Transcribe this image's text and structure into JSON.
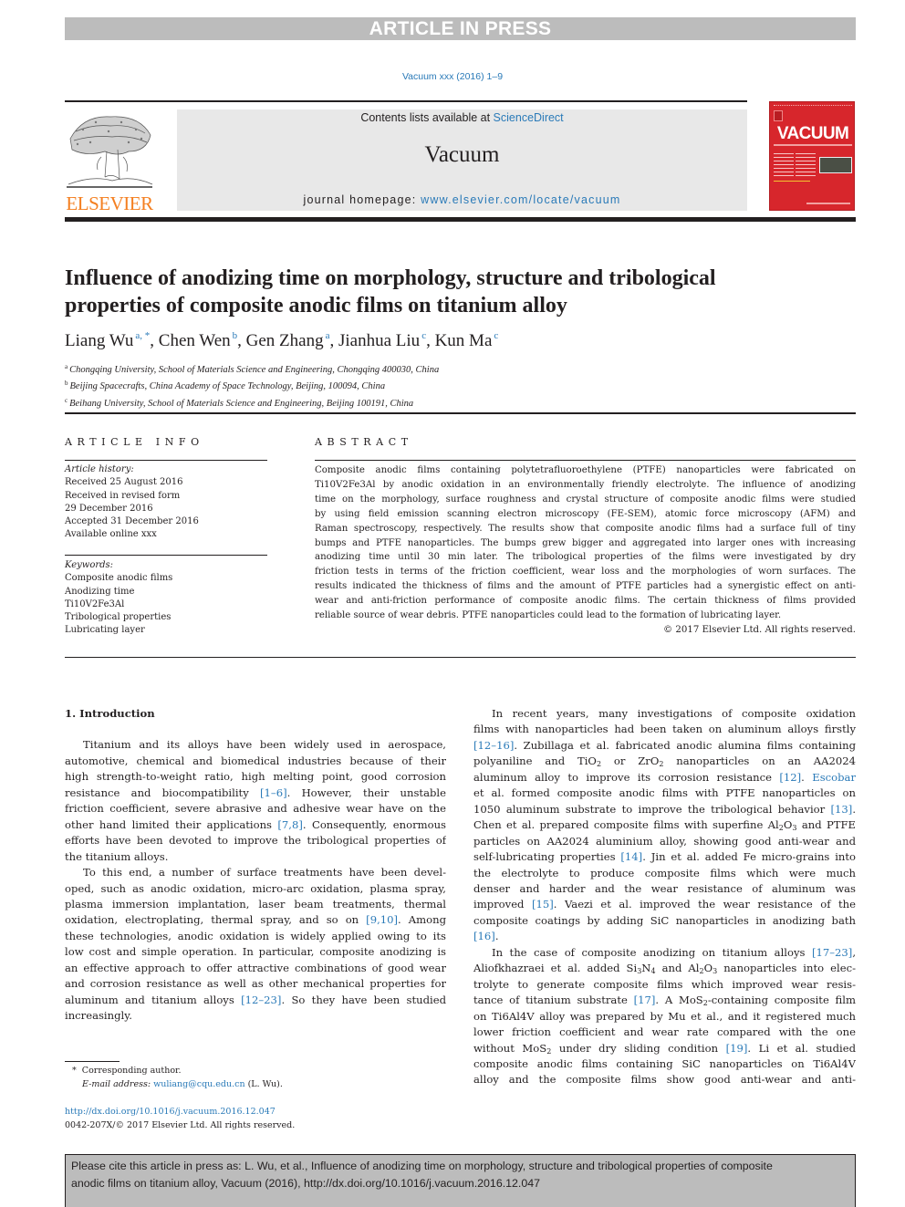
{
  "banner": {
    "label": "ARTICLE IN PRESS"
  },
  "journal_ref": "Vacuum xxx (2016) 1–9",
  "masthead": {
    "contents_prefix": "Contents lists available at ",
    "contents_link": "ScienceDirect",
    "journal_name": "Vacuum",
    "homepage_prefix": "journal homepage: ",
    "homepage_link": "www.elsevier.com/locate/vacuum",
    "publisher_logo_text": "ELSEVIER",
    "cover_title": "VACUUM"
  },
  "article": {
    "title_lines": [
      "Influence of anodizing time on morphology, structure and tribological",
      "properties of composite anodic films on titanium alloy"
    ],
    "authors": [
      {
        "name": "Liang Wu",
        "marks": "a, *"
      },
      {
        "name": "Chen Wen",
        "marks": "b"
      },
      {
        "name": "Gen Zhang",
        "marks": "a"
      },
      {
        "name": "Jianhua Liu",
        "marks": "c"
      },
      {
        "name": "Kun Ma",
        "marks": "c"
      }
    ],
    "affiliations": [
      {
        "mark": "a",
        "text": "Chongqing University, School of Materials Science and Engineering, Chongqing 400030, China"
      },
      {
        "mark": "b",
        "text": "Beijing Spacecrafts, China Academy of Space Technology, Beijing, 100094, China"
      },
      {
        "mark": "c",
        "text": "Beihang University, School of Materials Science and Engineering, Beijing 100191, China"
      }
    ]
  },
  "article_info": {
    "heading": "ARTICLE INFO",
    "history_label": "Article history:",
    "history": [
      "Received 25 August 2016",
      "Received in revised form",
      "29 December 2016",
      "Accepted 31 December 2016",
      "Available online xxx"
    ],
    "keywords_label": "Keywords:",
    "keywords": [
      "Composite anodic films",
      "Anodizing time",
      "Ti10V2Fe3Al",
      "Tribological properties",
      "Lubricating layer"
    ]
  },
  "abstract": {
    "heading": "ABSTRACT",
    "lines": [
      "Composite anodic films containing polytetrafluoroethylene (PTFE) nanoparticles were fabricated on",
      "Ti10V2Fe3Al by anodic oxidation in an environmentally friendly electrolyte. The influence of anodizing",
      "time on the morphology, surface roughness and crystal structure of composite anodic films were studied",
      "by using field emission scanning electron microscopy (FE-SEM), atomic force microscopy (AFM) and",
      "Raman spectroscopy, respectively. The results show that composite anodic films had a surface full of tiny",
      "bumps and PTFE nanoparticles. The bumps grew bigger and aggregated into larger ones with increasing",
      "anodizing time until 30 min later. The tribological properties of the films were investigated by dry",
      "friction tests in terms of the friction coefficient, wear loss and the morphologies of worn surfaces. The",
      "results indicated the thickness of films and the amount of PTFE particles had a synergistic effect on anti-",
      "wear and anti-friction performance of composite anodic films. The certain thickness of films provided"
    ],
    "last_line": "reliable source of wear debris. PTFE nanoparticles could lead to the formation of lubricating layer.",
    "copyright": "© 2017 Elsevier Ltd. All rights reserved."
  },
  "body": {
    "section_heading": "1.  Introduction",
    "left": {
      "p1": {
        "lines": [
          [
            "Titanium and its alloys have been widely used in aerospace,"
          ],
          [
            "automotive, chemical and biomedical industries because of their"
          ],
          [
            "high strength-to-weight ratio, high melting point, good corrosion"
          ],
          [
            "resistance and biocompatibility ",
            "[1–6]",
            ". However, their unstable"
          ],
          [
            "friction coefficient, severe abrasive and adhesive wear have on the"
          ],
          [
            "other hand limited their applications ",
            "[7,8]",
            ". Consequently, enormous"
          ],
          [
            "efforts have been devoted to improve the tribological properties of"
          ]
        ],
        "last": "the titanium alloys."
      },
      "p2": {
        "lines": [
          [
            "To this end, a number of surface treatments have been devel-"
          ],
          [
            "oped, such as anodic oxidation, micro-arc oxidation, plasma spray,"
          ],
          [
            "plasma immersion implantation, laser beam treatments, thermal"
          ],
          [
            "oxidation, electroplating, thermal spray, and so on ",
            "[9,10]",
            ". Among"
          ],
          [
            "these technologies, anodic oxidation is widely applied owing to its"
          ],
          [
            "low cost and simple operation. In particular, composite anodizing is"
          ],
          [
            "an effective approach to offer attractive combinations of good wear"
          ],
          [
            "and corrosion resistance as well as other mechanical properties for"
          ],
          [
            "aluminum and titanium alloys ",
            "[12–23]",
            ". So they have been studied"
          ]
        ],
        "last": "increasingly."
      }
    },
    "right": {
      "p1": {
        "l1": "In recent years, many investigations of composite oxidation",
        "l2": "films with nanoparticles had been taken on aluminum alloys firstly",
        "l3_cite": "[12–16]",
        "l3_text": ". Zubillaga et al. fabricated anodic alumina films containing",
        "l4_a": "polyaniline and TiO",
        "l4_b": " or ZrO",
        "l4_c": " nanoparticles on an AA2024",
        "l5_text": "aluminum alloy to improve its corrosion resistance ",
        "l5_cite": "[12]",
        "l5_link": "Escobar",
        "l6": "et al. formed composite anodic films with PTFE nanoparticles on",
        "l7_text": "1050 aluminum substrate to improve the tribological behavior ",
        "l7_cite": "[13]",
        "l8_a": "Chen et al. prepared composite films with superfine Al",
        "l8_b": "O",
        "l8_c": " and PTFE",
        "l9": "particles on AA2024 aluminium alloy, showing good anti-wear and",
        "l10_text": "self-lubricating properties ",
        "l10_cite": "[14]",
        "l10_rest": ". Jin et al. added Fe micro-grains into",
        "l11": "the electrolyte to produce composite films which were much",
        "l12": "denser and harder and the wear resistance of aluminum was",
        "l13_text": "improved ",
        "l13_cite": "[15]",
        "l13_rest": ". Vaezi et al. improved the wear resistance of the",
        "l14": "composite coatings by adding SiC nanoparticles in anodizing bath",
        "l15_cite": "[16]"
      },
      "p2": {
        "l1_text": "In the case of composite anodizing on titanium alloys ",
        "l1_cite": "[17–23]",
        "l2_a": "Aliofkhazraei et al. added Si",
        "l2_b": "N",
        "l2_c": " and Al",
        "l2_d": "O",
        "l2_e": " nanoparticles into elec-",
        "l3": "trolyte to generate composite films which improved wear resis-",
        "l4_text": "tance of titanium substrate ",
        "l4_cite": "[17]",
        "l4_rest": ". A MoS",
        "l4_rest2": "-containing composite film",
        "l5": "on Ti6Al4V alloy was prepared by Mu et al., and it registered much",
        "l6": "lower friction coefficient and wear rate compared with the one",
        "l7_a": "without MoS",
        "l7_b": " under dry sliding condition ",
        "l7_cite": "[19]",
        "l7_rest": ". Li et al. studied",
        "l8": "composite anodic films containing SiC nanoparticles on Ti6Al4V",
        "l9": "alloy and the composite films show good anti-wear and anti-"
      }
    }
  },
  "footnote": {
    "star": "*",
    "corresponding": "Corresponding author.",
    "email_label": "E-mail address:",
    "email": "wuliang@cqu.edu.cn",
    "email_suffix": " (L. Wu)."
  },
  "doi": {
    "link": "http://dx.doi.org/10.1016/j.vacuum.2016.12.047",
    "issn": "0042-207X/© 2017 Elsevier Ltd. All rights reserved."
  },
  "cite_box": {
    "line1": "Please cite this article in press as: L. Wu, et al., Influence of anodizing time on morphology, structure and tribological properties of composite",
    "line2": "anodic films on titanium alloy, Vacuum (2016), http://dx.doi.org/10.1016/j.vacuum.2016.12.047"
  },
  "colors": {
    "link": "#2a7ab8",
    "elsevier_orange": "#f47f20",
    "cover_red": "#d7262c",
    "banner_gray": "#bcbcbc"
  }
}
